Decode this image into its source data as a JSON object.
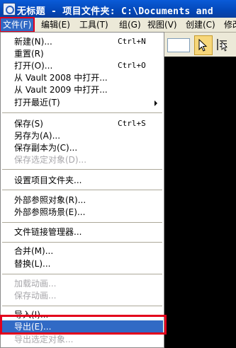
{
  "window": {
    "title": "无标题 - 项目文件夹: C:\\Documents and"
  },
  "menubar": {
    "items": [
      "文件(F)",
      "编辑(E)",
      "工具(T)",
      "组(G)",
      "视图(V)",
      "创建(C)",
      "修改"
    ]
  },
  "menu": {
    "items": [
      {
        "label": "新建(N)...",
        "accel": "Ctrl+N",
        "disabled": false
      },
      {
        "label": "重置(R)",
        "accel": "",
        "disabled": false
      },
      {
        "label": "打开(O)...",
        "accel": "Ctrl+O",
        "disabled": false
      },
      {
        "label": "从 Vault 2008 中打开...",
        "accel": "",
        "disabled": false
      },
      {
        "label": "从 Vault 2009 中打开...",
        "accel": "",
        "disabled": false
      },
      {
        "label": "打开最近(T)",
        "accel": "",
        "disabled": false,
        "submenu": true
      },
      {
        "label": "保存(S)",
        "accel": "Ctrl+S",
        "disabled": false
      },
      {
        "label": "另存为(A)...",
        "accel": "",
        "disabled": false
      },
      {
        "label": "保存副本为(C)...",
        "accel": "",
        "disabled": false
      },
      {
        "label": "保存选定对象(D)...",
        "accel": "",
        "disabled": true
      },
      {
        "label": "设置项目文件夹...",
        "accel": "",
        "disabled": false
      },
      {
        "label": "外部参照对象(R)...",
        "accel": "",
        "disabled": false
      },
      {
        "label": "外部参照场景(E)...",
        "accel": "",
        "disabled": false
      },
      {
        "label": "文件链接管理器...",
        "accel": "",
        "disabled": false
      },
      {
        "label": "合并(M)...",
        "accel": "",
        "disabled": false
      },
      {
        "label": "替换(L)...",
        "accel": "",
        "disabled": false
      },
      {
        "label": "加载动画...",
        "accel": "",
        "disabled": true
      },
      {
        "label": "保存动画...",
        "accel": "",
        "disabled": true
      },
      {
        "label": "导入(I)...",
        "accel": "",
        "disabled": false
      },
      {
        "label": "导出(E)...",
        "accel": "",
        "disabled": false,
        "highlighted": true
      },
      {
        "label": "导出选定对象...",
        "accel": "",
        "disabled": true
      }
    ]
  },
  "colors": {
    "highlight": "#316ac5",
    "annotation": "#e3001b",
    "menubar_bg": "#ece9d8"
  }
}
